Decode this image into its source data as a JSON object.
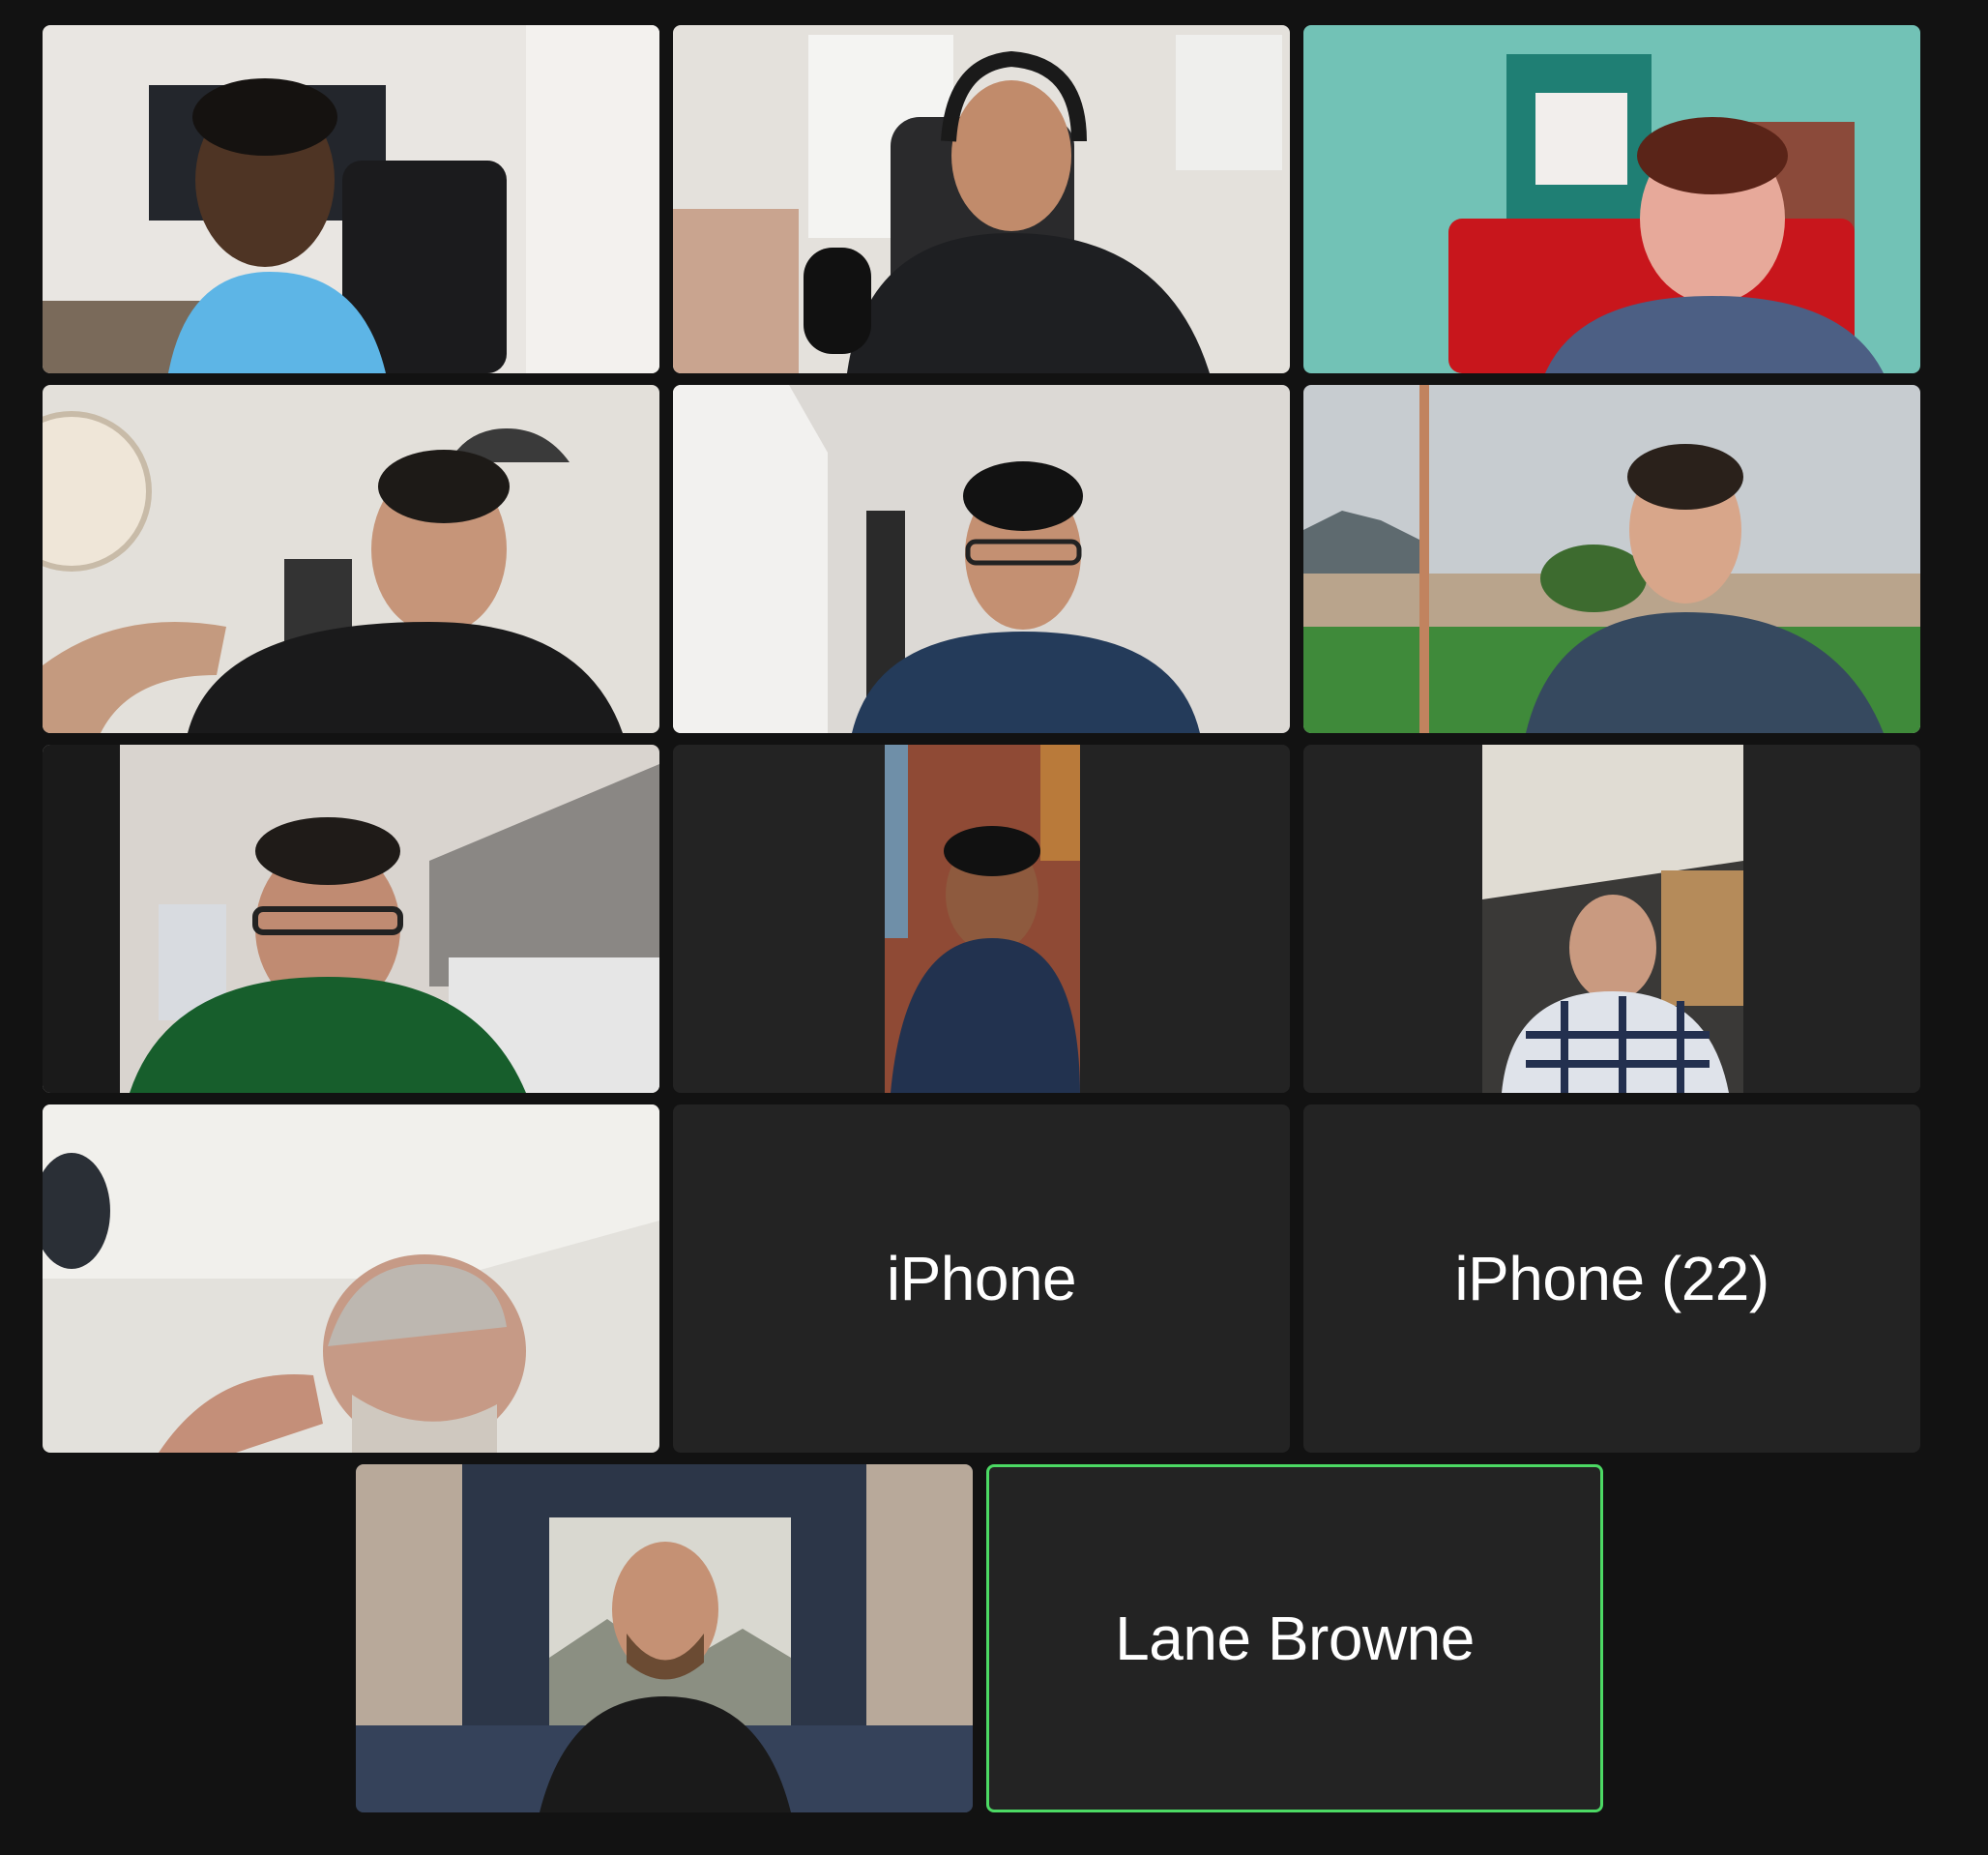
{
  "meeting": {
    "participants": [
      {
        "id": "p1",
        "type": "video"
      },
      {
        "id": "p2",
        "type": "video"
      },
      {
        "id": "p3",
        "type": "video"
      },
      {
        "id": "p4",
        "type": "video"
      },
      {
        "id": "p5",
        "type": "video"
      },
      {
        "id": "p6",
        "type": "video"
      },
      {
        "id": "p7",
        "type": "video"
      },
      {
        "id": "p8",
        "type": "video"
      },
      {
        "id": "p9",
        "type": "video"
      },
      {
        "id": "p10",
        "type": "video"
      },
      {
        "id": "p11",
        "type": "name",
        "name": "iPhone"
      },
      {
        "id": "p12",
        "type": "name",
        "name": "iPhone (22)"
      },
      {
        "id": "p13",
        "type": "video"
      },
      {
        "id": "p14",
        "type": "name",
        "name": "Lane Browne",
        "active_speaker": true
      }
    ]
  },
  "colors": {
    "background": "#121212",
    "tile_background": "#232323",
    "active_speaker_border": "#4cd964",
    "name_text": "#ffffff"
  }
}
